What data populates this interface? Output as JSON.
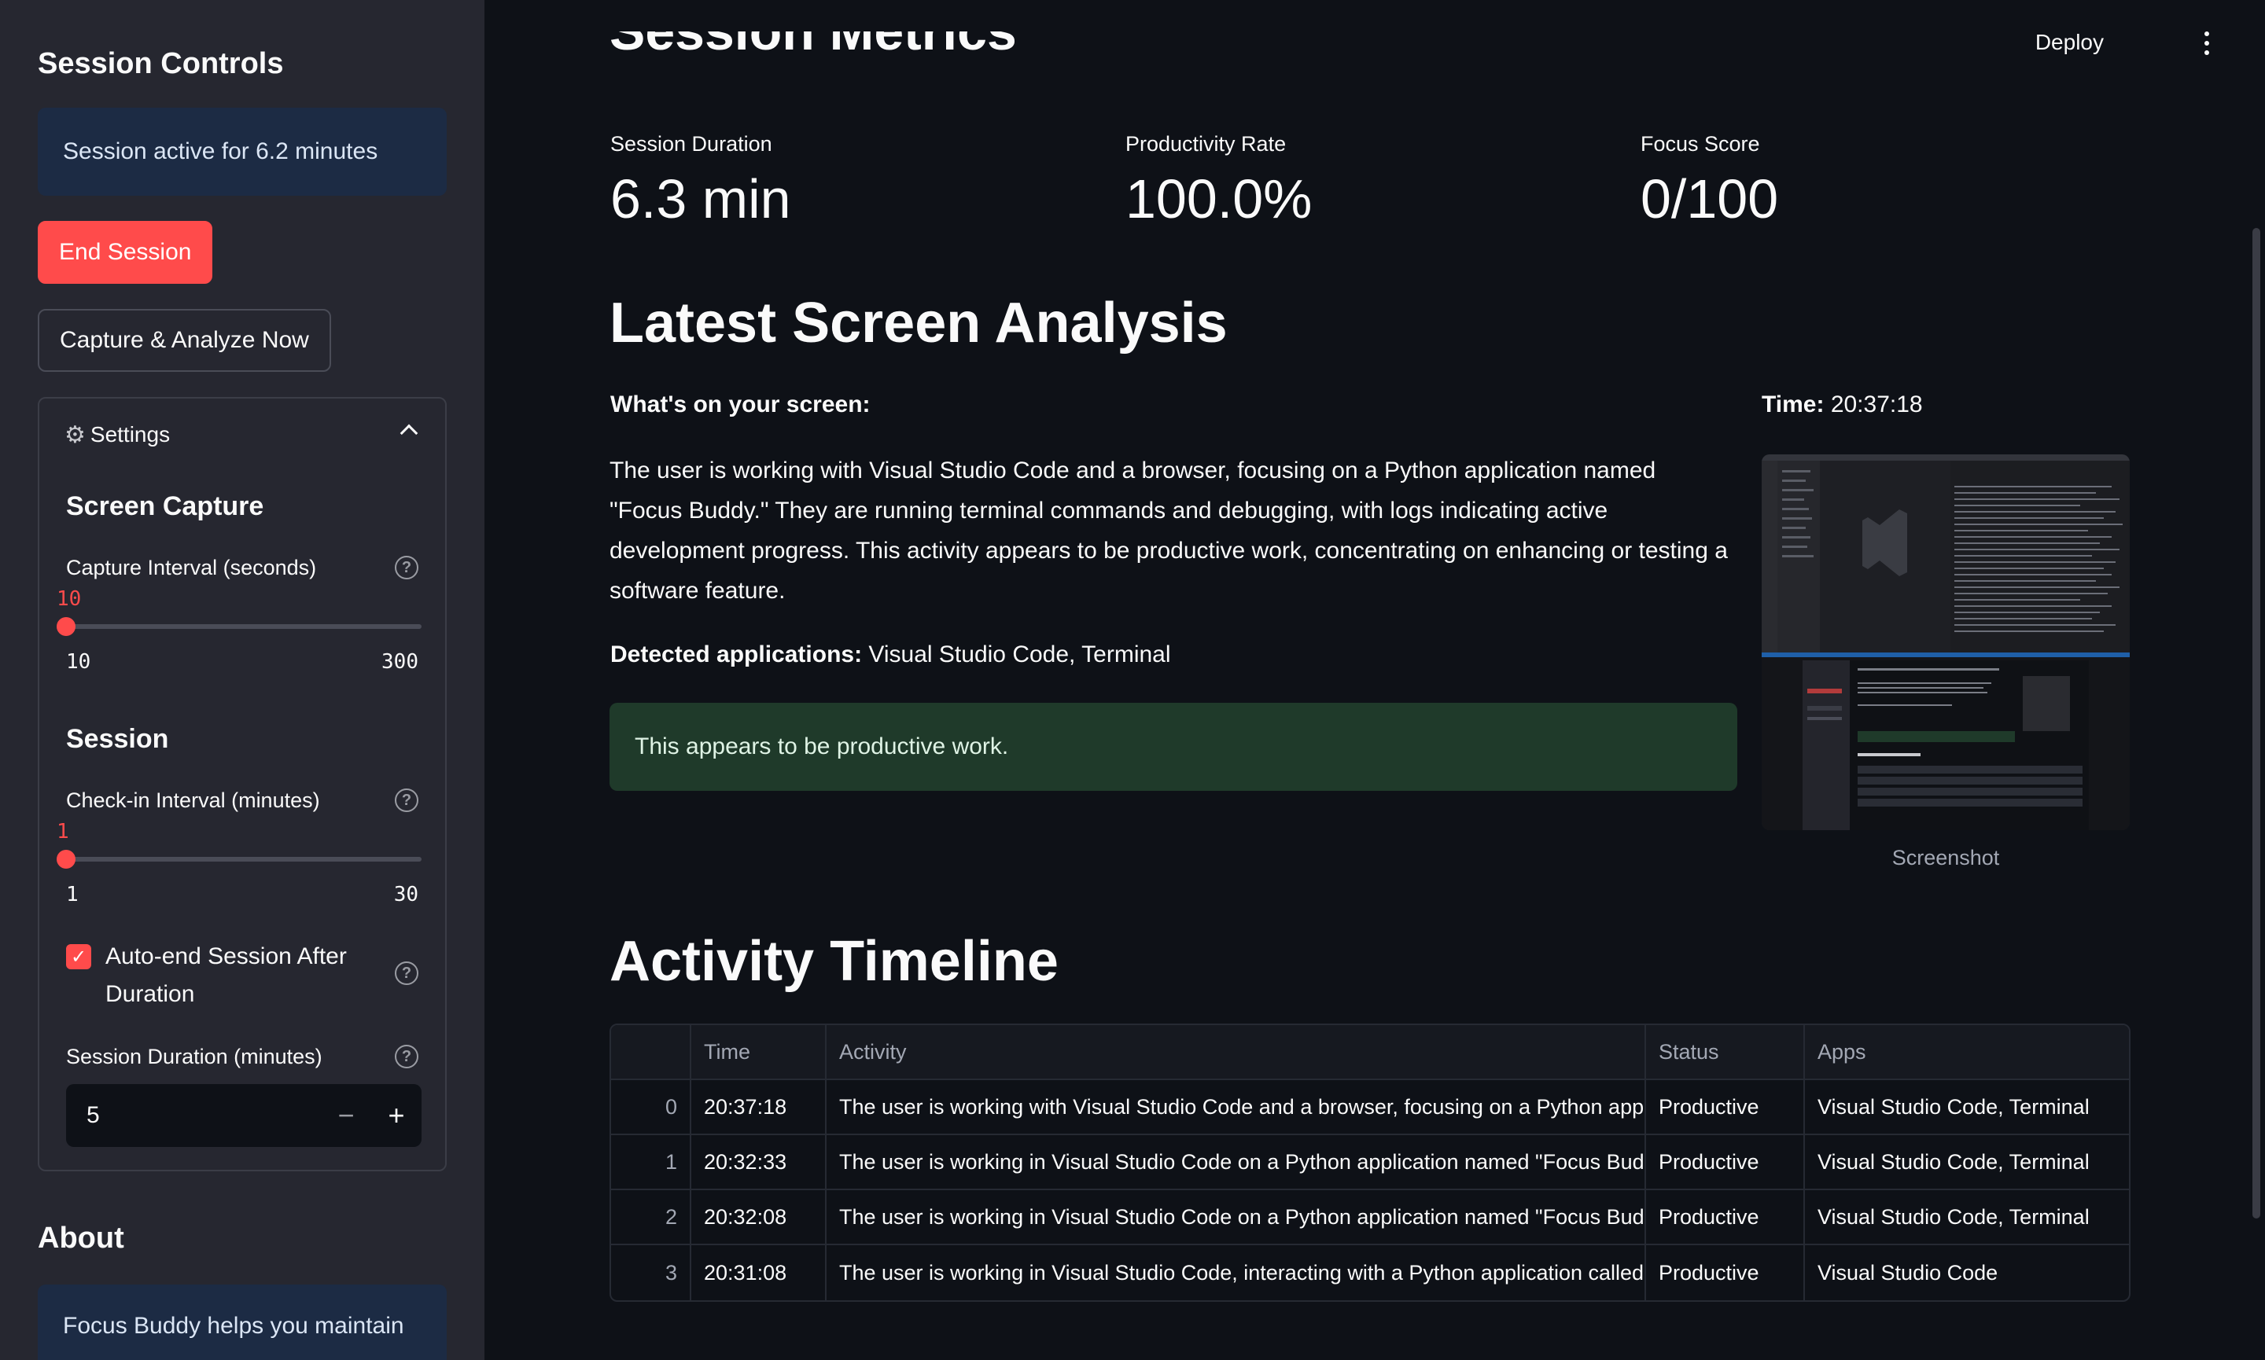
{
  "sidebar": {
    "title": "Session Controls",
    "status_info": "Session active for 6.2 minutes",
    "end_session_label": "End Session",
    "capture_label": "Capture & Analyze Now",
    "settings": {
      "expander_label": "Settings",
      "screen_capture_heading": "Screen Capture",
      "capture_interval": {
        "label": "Capture Interval (seconds)",
        "value": "10",
        "min": "10",
        "max": "300"
      },
      "session_heading": "Session",
      "checkin_interval": {
        "label": "Check-in Interval (minutes)",
        "value": "1",
        "min": "1",
        "max": "30"
      },
      "auto_end": {
        "label": "Auto-end Session After Duration",
        "checked": true
      },
      "session_duration": {
        "label": "Session Duration (minutes)",
        "value": "5"
      }
    },
    "about_heading": "About",
    "about_text": "Focus Buddy helps you maintain"
  },
  "topbar": {
    "deploy_label": "Deploy"
  },
  "metrics": {
    "heading": "Session Metrics",
    "items": [
      {
        "label": "Session Duration",
        "value": "6.3 min"
      },
      {
        "label": "Productivity Rate",
        "value": "100.0%"
      },
      {
        "label": "Focus Score",
        "value": "0/100"
      }
    ]
  },
  "analysis": {
    "heading": "Latest Screen Analysis",
    "screen_label": "What's on your screen:",
    "description": "The user is working with Visual Studio Code and a browser, focusing on a Python application named \"Focus Buddy.\" They are running terminal commands and debugging, with logs indicating active development progress. This activity appears to be productive work, concentrating on enhancing or testing a software feature.",
    "apps_label": "Detected applications:",
    "apps_value": "Visual Studio Code, Terminal",
    "verdict": "This appears to be productive work.",
    "time_label": "Time:",
    "time_value": "20:37:18",
    "screenshot_caption": "Screenshot"
  },
  "timeline": {
    "heading": "Activity Timeline",
    "columns": [
      "",
      "Time",
      "Activity",
      "Status",
      "Apps"
    ],
    "rows": [
      {
        "idx": "0",
        "time": "20:37:18",
        "activity": "The user is working with Visual Studio Code and a browser, focusing on a Python applica",
        "status": "Productive",
        "apps": "Visual Studio Code, Terminal"
      },
      {
        "idx": "1",
        "time": "20:32:33",
        "activity": "The user is working in Visual Studio Code on a Python application named \"Focus Buddy,\"",
        "status": "Productive",
        "apps": "Visual Studio Code, Terminal"
      },
      {
        "idx": "2",
        "time": "20:32:08",
        "activity": "The user is working in Visual Studio Code on a Python application named \"Focus Buddy,\"",
        "status": "Productive",
        "apps": "Visual Studio Code, Terminal"
      },
      {
        "idx": "3",
        "time": "20:31:08",
        "activity": "The user is working in Visual Studio Code, interacting with a Python application called \"F",
        "status": "Productive",
        "apps": "Visual Studio Code"
      }
    ]
  },
  "colors": {
    "background": "#0e1117",
    "sidebar": "#262730",
    "accent": "#ff4b4b",
    "info_bg": "#1c2b44",
    "success_bg": "#1f3a2a"
  }
}
